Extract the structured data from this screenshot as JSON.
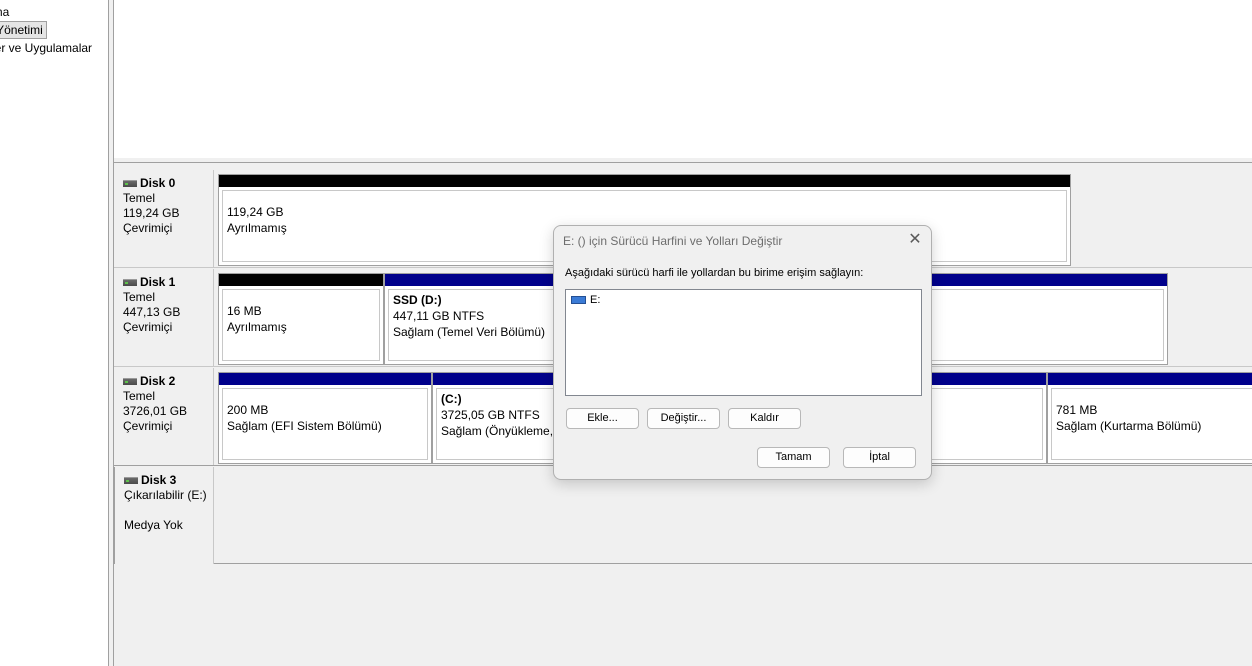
{
  "tree": {
    "items": [
      {
        "label": "ama"
      },
      {
        "label": "k Yönetimi",
        "selected": true
      },
      {
        "label": "cler ve Uygulamalar"
      }
    ]
  },
  "disks": [
    {
      "name": "Disk 0",
      "type": "Temel",
      "size": "119,24 GB",
      "status": "Çevrimiçi"
    },
    {
      "name": "Disk 1",
      "type": "Temel",
      "size": "447,13 GB",
      "status": "Çevrimiçi"
    },
    {
      "name": "Disk 2",
      "type": "Temel",
      "size": "3726,01 GB",
      "status": "Çevrimiçi"
    },
    {
      "name": "Disk 3",
      "type": "Çıkarılabilir (E:)",
      "status": "Medya Yok"
    }
  ],
  "partitions": {
    "disk0_unalloc": {
      "size": "119,24 GB",
      "status": "Ayrılmamış"
    },
    "disk1_unalloc": {
      "size": "16 MB",
      "status": "Ayrılmamış"
    },
    "disk1_ssd": {
      "name": "SSD  (D:)",
      "size": "447,11 GB NTFS",
      "status": "Sağlam (Temel Veri Bölümü)"
    },
    "disk2_efi": {
      "size": "200 MB",
      "status": "Sağlam (EFI Sistem Bölümü)"
    },
    "disk2_c": {
      "name": " (C:)",
      "size": "3725,05 GB NTFS",
      "status": "Sağlam (Önyükleme,"
    },
    "disk2_recovery": {
      "size": "781 MB",
      "status": "Sağlam (Kurtarma Bölümü)"
    }
  },
  "dialog": {
    "title": "E: () için Sürücü Harfini ve Yolları Değiştir",
    "close_glyph": "✕",
    "description": "Aşağıdaki sürücü harfi ile yollardan bu birime erişim sağlayın:",
    "list_items": [
      "E:"
    ],
    "buttons": {
      "add": "Ekle...",
      "change": "Değiştir...",
      "remove": "Kaldır",
      "ok": "Tamam",
      "cancel": "İptal"
    }
  },
  "colors": {
    "primary_partition_bar": "#00008b",
    "unallocated_bar": "#000000"
  },
  "icons": {
    "disk": "disk-drive-icon",
    "volume": "drive-letter-icon",
    "close": "close-icon"
  }
}
